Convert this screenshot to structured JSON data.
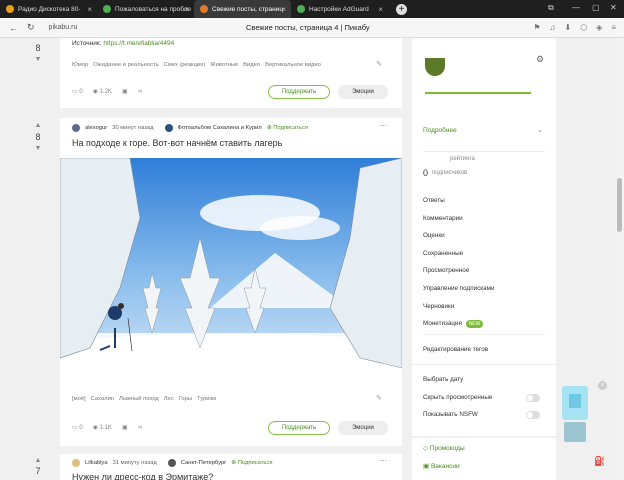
{
  "tabs": [
    {
      "label": "Радио Дискотека 80-",
      "active": false,
      "icon_color": "#e8a019"
    },
    {
      "label": "Пожаловаться на пробле",
      "active": false,
      "icon_color": "#4caf50"
    },
    {
      "label": "Свежие посты, страниц",
      "active": true,
      "icon_color": "#e07a2a"
    },
    {
      "label": "Настройки AdGuard",
      "active": false,
      "icon_color": "#4caf50"
    }
  ],
  "address": {
    "url": "pikabu.ru",
    "page_title": "Свежие посты, страница 4 | Пикабу"
  },
  "post_prev": {
    "votes": "8",
    "source_prefix": "Источник: ",
    "source_link": "https://t.me/efiablia/4494",
    "tags": [
      "Юмор",
      "Ожидание и реальность",
      "Смех (реакция)",
      "Животные",
      "Видео",
      "Вертикальное видео"
    ],
    "comments": "0",
    "views": "1.2K",
    "support": "Поддержать",
    "emotions": "Эмоции"
  },
  "post_main": {
    "votes": "8",
    "author": "alexogur",
    "time": "30 минут назад",
    "community": "Фотоальбом Сахалина и Курил",
    "subscribe": "Подписаться",
    "title": "На подходе к горе. Вот-вот начнём ставить лагерь",
    "tags": [
      "[моё]",
      "Сахалин",
      "Лыжный поход",
      "Лес",
      "Горы",
      "Туризм"
    ],
    "comments": "0",
    "views": "1.1K",
    "support": "Поддержать",
    "emotions": "Эмоции"
  },
  "post_next": {
    "votes": "7",
    "author": "Lilkablya",
    "time": "31 минуту назад",
    "community": "Санкт-Петербург",
    "subscribe": "Подписаться",
    "title": "Нужен ли дресс-код в Эрмитаже?"
  },
  "sidebar": {
    "more": "Подробнее",
    "rating_label": "рейтинга",
    "subs_count": "0",
    "subs_label": "подписчиков",
    "menu": [
      "Ответы",
      "Комментарии",
      "Оценки",
      "Сохраненные",
      "Просмотренное",
      "Управление подписками",
      "Черновики",
      "Монетизация"
    ],
    "new_badge": "NEW",
    "tags_edit": "Редактирование тегов",
    "choose_date": "Выбрать дату",
    "hide_viewed": "Скрыть просмотренные",
    "show_nsfw": "Показывать NSFW",
    "promo": "Промокоды",
    "vacancies": "Вакансии"
  }
}
